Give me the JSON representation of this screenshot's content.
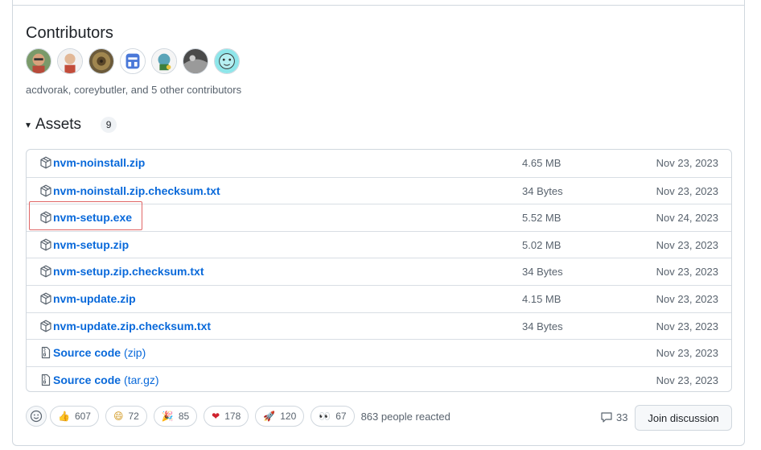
{
  "contributors": {
    "title": "Contributors",
    "summary": "acdvorak, coreybutler, and 5 other contributors",
    "avatars": [
      "acdvorak-avatar",
      "coreybutler-avatar",
      "contributor-3-avatar",
      "contributor-4-avatar",
      "contributor-5-avatar",
      "contributor-6-avatar",
      "contributor-7-avatar"
    ]
  },
  "assets": {
    "caret": "▾",
    "title": "Assets",
    "count": "9",
    "rows": [
      {
        "name": "nvm-noinstall.zip",
        "ext": "",
        "size": "4.65 MB",
        "date": "Nov 23, 2023",
        "icon": "package-icon"
      },
      {
        "name": "nvm-noinstall.zip.checksum.txt",
        "ext": "",
        "size": "34 Bytes",
        "date": "Nov 23, 2023",
        "icon": "package-icon"
      },
      {
        "name": "nvm-setup.exe",
        "ext": "",
        "size": "5.52 MB",
        "date": "Nov 24, 2023",
        "icon": "package-icon"
      },
      {
        "name": "nvm-setup.zip",
        "ext": "",
        "size": "5.02 MB",
        "date": "Nov 23, 2023",
        "icon": "package-icon"
      },
      {
        "name": "nvm-setup.zip.checksum.txt",
        "ext": "",
        "size": "34 Bytes",
        "date": "Nov 23, 2023",
        "icon": "package-icon"
      },
      {
        "name": "nvm-update.zip",
        "ext": "",
        "size": "4.15 MB",
        "date": "Nov 23, 2023",
        "icon": "package-icon"
      },
      {
        "name": "nvm-update.zip.checksum.txt",
        "ext": "",
        "size": "34 Bytes",
        "date": "Nov 23, 2023",
        "icon": "package-icon"
      },
      {
        "name": "Source code",
        "ext": "(zip)",
        "size": "",
        "date": "Nov 23, 2023",
        "icon": "file-zip-icon"
      },
      {
        "name": "Source code",
        "ext": "(tar.gz)",
        "size": "",
        "date": "Nov 23, 2023",
        "icon": "file-zip-icon"
      }
    ]
  },
  "reactions": {
    "items": [
      {
        "emoji": "👍",
        "count": "607",
        "icon": "thumbs-up-icon"
      },
      {
        "emoji": "😄",
        "count": "72",
        "icon": "laugh-icon"
      },
      {
        "emoji": "🎉",
        "count": "85",
        "icon": "hooray-icon"
      },
      {
        "emoji": "❤",
        "count": "178",
        "icon": "heart-icon"
      },
      {
        "emoji": "🚀",
        "count": "120",
        "icon": "rocket-icon"
      },
      {
        "emoji": "👀",
        "count": "67",
        "icon": "eyes-icon"
      }
    ],
    "summary": "863 people reacted"
  },
  "discussion": {
    "count": "33",
    "join_label": "Join discussion"
  },
  "colors": {
    "link": "#0969da",
    "muted": "#59636e",
    "border": "#d0d7de",
    "highlight": "#e06666"
  }
}
